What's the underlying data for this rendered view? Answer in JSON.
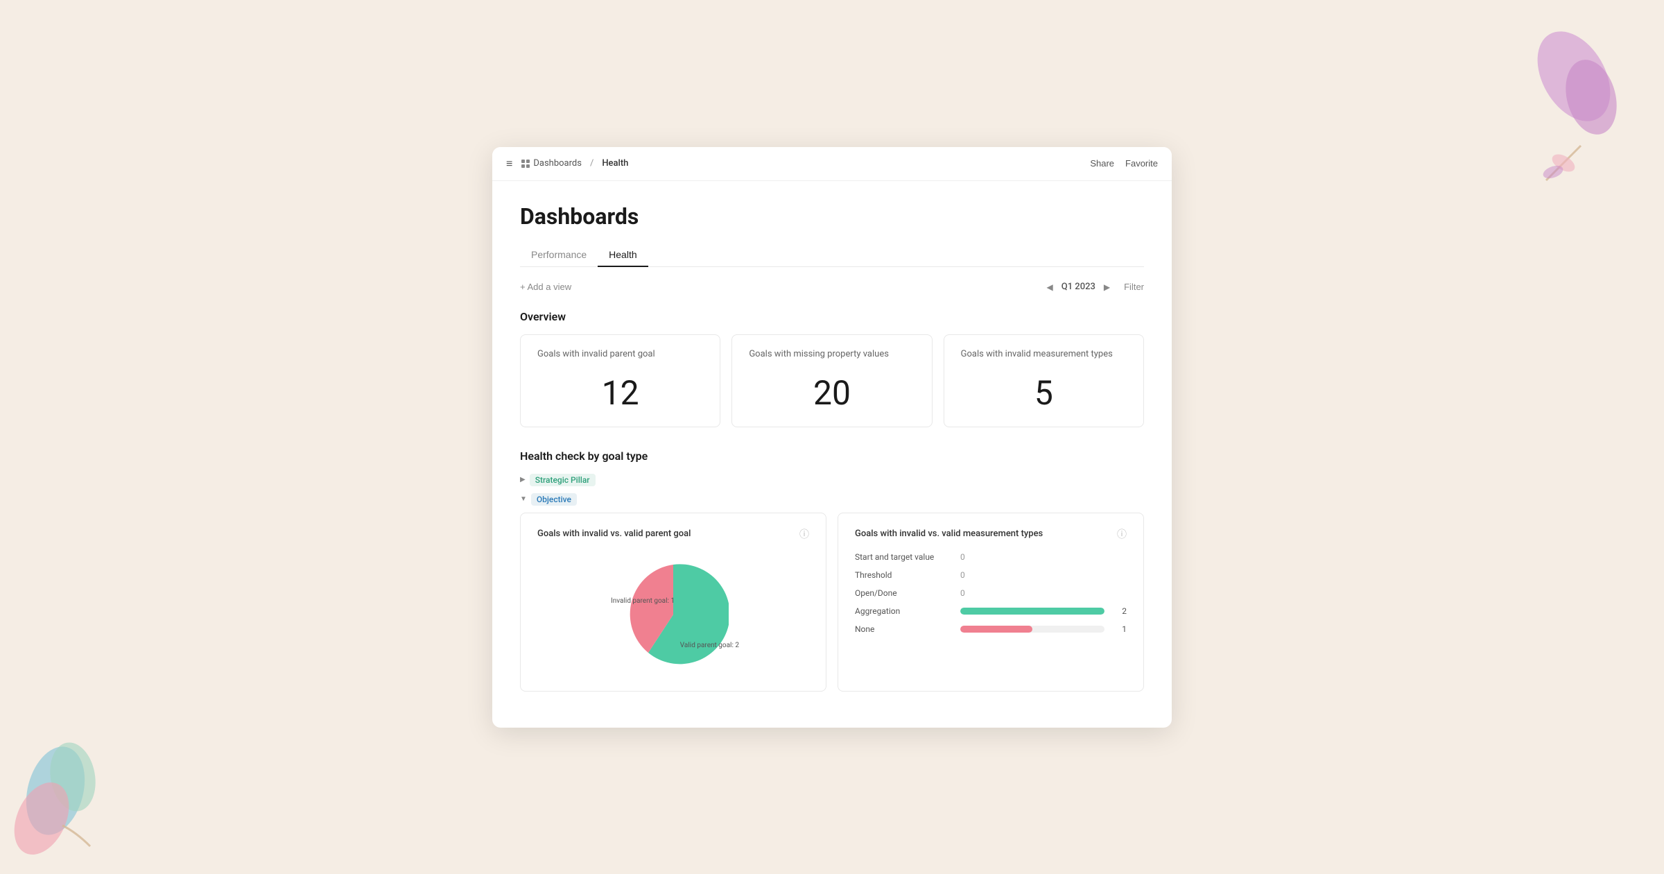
{
  "page": {
    "background_color": "#f5ede4"
  },
  "breadcrumb": {
    "menu_icon": "≡",
    "home": "Dashboards",
    "separator": "/",
    "current": "Health"
  },
  "top_bar": {
    "share_label": "Share",
    "favorite_label": "Favorite"
  },
  "page_title": "Dashboards",
  "tabs": [
    {
      "id": "performance",
      "label": "Performance",
      "active": false
    },
    {
      "id": "health",
      "label": "Health",
      "active": true
    }
  ],
  "toolbar": {
    "add_view_label": "+ Add a view",
    "period": "Q1 2023",
    "filter_label": "Filter"
  },
  "overview": {
    "section_title": "Overview",
    "cards": [
      {
        "id": "invalid-parent",
        "title": "Goals with invalid parent goal",
        "value": "12"
      },
      {
        "id": "missing-property",
        "title": "Goals with missing property values",
        "value": "20"
      },
      {
        "id": "invalid-measurement",
        "title": "Goals with invalid measurement types",
        "value": "5"
      }
    ]
  },
  "health_check": {
    "section_title": "Health check by goal type",
    "groups": [
      {
        "id": "strategic-pillar",
        "label": "Strategic Pillar",
        "tag_class": "tag-strategic",
        "expanded": false,
        "arrow": "▶"
      },
      {
        "id": "objective",
        "label": "Objective",
        "tag_class": "tag-objective",
        "expanded": true,
        "arrow": "▼"
      }
    ]
  },
  "charts": {
    "parent_goal": {
      "title": "Goals with invalid vs. valid parent goal",
      "info_icon": "ⓘ",
      "pie": {
        "invalid_label": "Invalid parent goal: 1",
        "valid_label": "Valid parent goal: 2",
        "invalid_color": "#f08090",
        "valid_color": "#4ecba4",
        "invalid_pct": 33,
        "valid_pct": 67
      }
    },
    "measurement_types": {
      "title": "Goals with invalid vs. valid measurement types",
      "info_icon": "ⓘ",
      "rows": [
        {
          "id": "start-target",
          "label": "Start and target value",
          "value": 0,
          "bar_pct": 0,
          "bar_type": "none"
        },
        {
          "id": "threshold",
          "label": "Threshold",
          "value": 0,
          "bar_pct": 0,
          "bar_type": "none"
        },
        {
          "id": "open-done",
          "label": "Open/Done",
          "value": 0,
          "bar_pct": 0,
          "bar_type": "none"
        },
        {
          "id": "aggregation",
          "label": "Aggregation",
          "value": 2,
          "bar_pct": 100,
          "bar_type": "green"
        },
        {
          "id": "none",
          "label": "None",
          "value": 1,
          "bar_pct": 50,
          "bar_type": "pink"
        }
      ]
    }
  }
}
